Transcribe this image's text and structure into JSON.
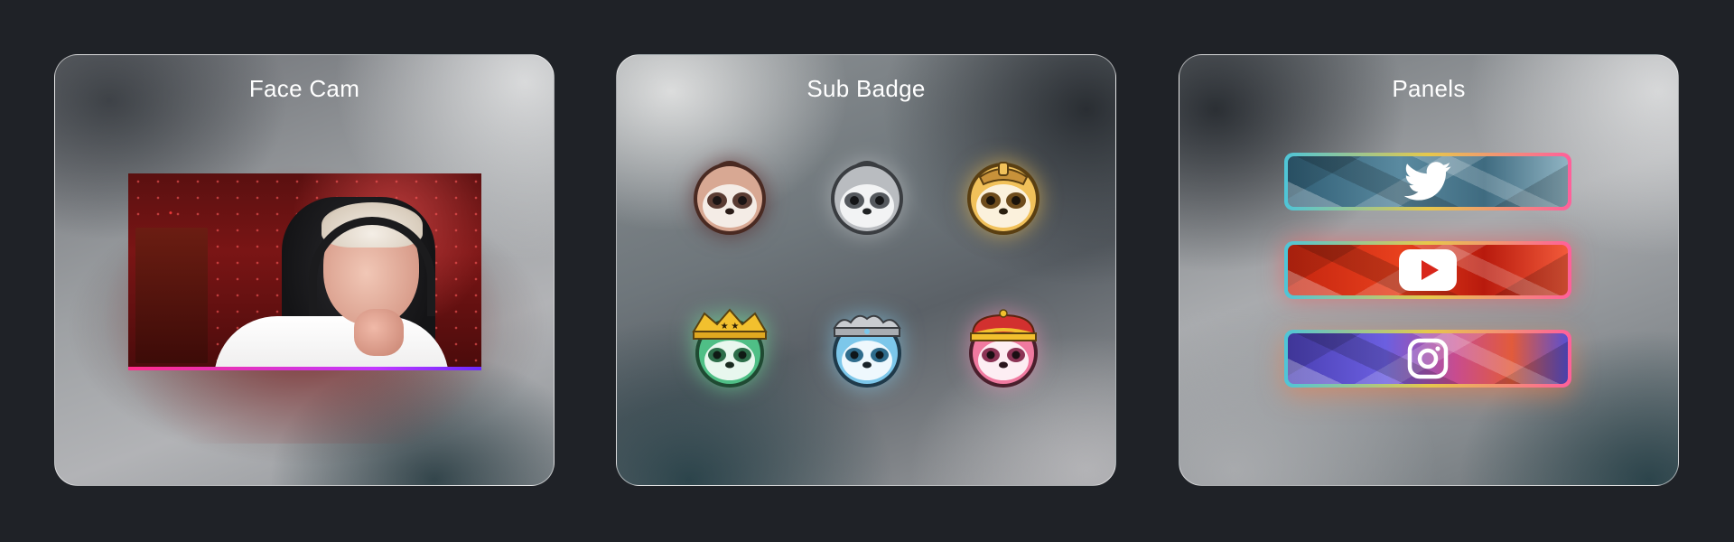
{
  "cards": {
    "facecam": {
      "title": "Face Cam"
    },
    "subbadge": {
      "title": "Sub Badge",
      "badges": [
        {
          "name": "sloth-badge-bronze",
          "color": "#c9917c"
        },
        {
          "name": "sloth-badge-silver",
          "color": "#c9ccd0"
        },
        {
          "name": "sloth-badge-gold",
          "color": "#f0c35a"
        },
        {
          "name": "sloth-badge-green-crown",
          "color": "#4fbf86"
        },
        {
          "name": "sloth-badge-blue-crown",
          "color": "#7cc7ea"
        },
        {
          "name": "sloth-badge-pink-crown",
          "color": "#f07aa0"
        }
      ]
    },
    "panels": {
      "title": "Panels",
      "buttons": [
        {
          "name": "twitter-icon"
        },
        {
          "name": "youtube-icon"
        },
        {
          "name": "instagram-icon"
        }
      ]
    }
  },
  "colors": {
    "background": "#1f2227",
    "cam_bar_start": "#ff2d8a",
    "cam_bar_end": "#6b2bff",
    "panel_border_start": "#4ec5d8",
    "panel_border_mid": "#e6c84b",
    "panel_border_end": "#ff5f9b"
  }
}
